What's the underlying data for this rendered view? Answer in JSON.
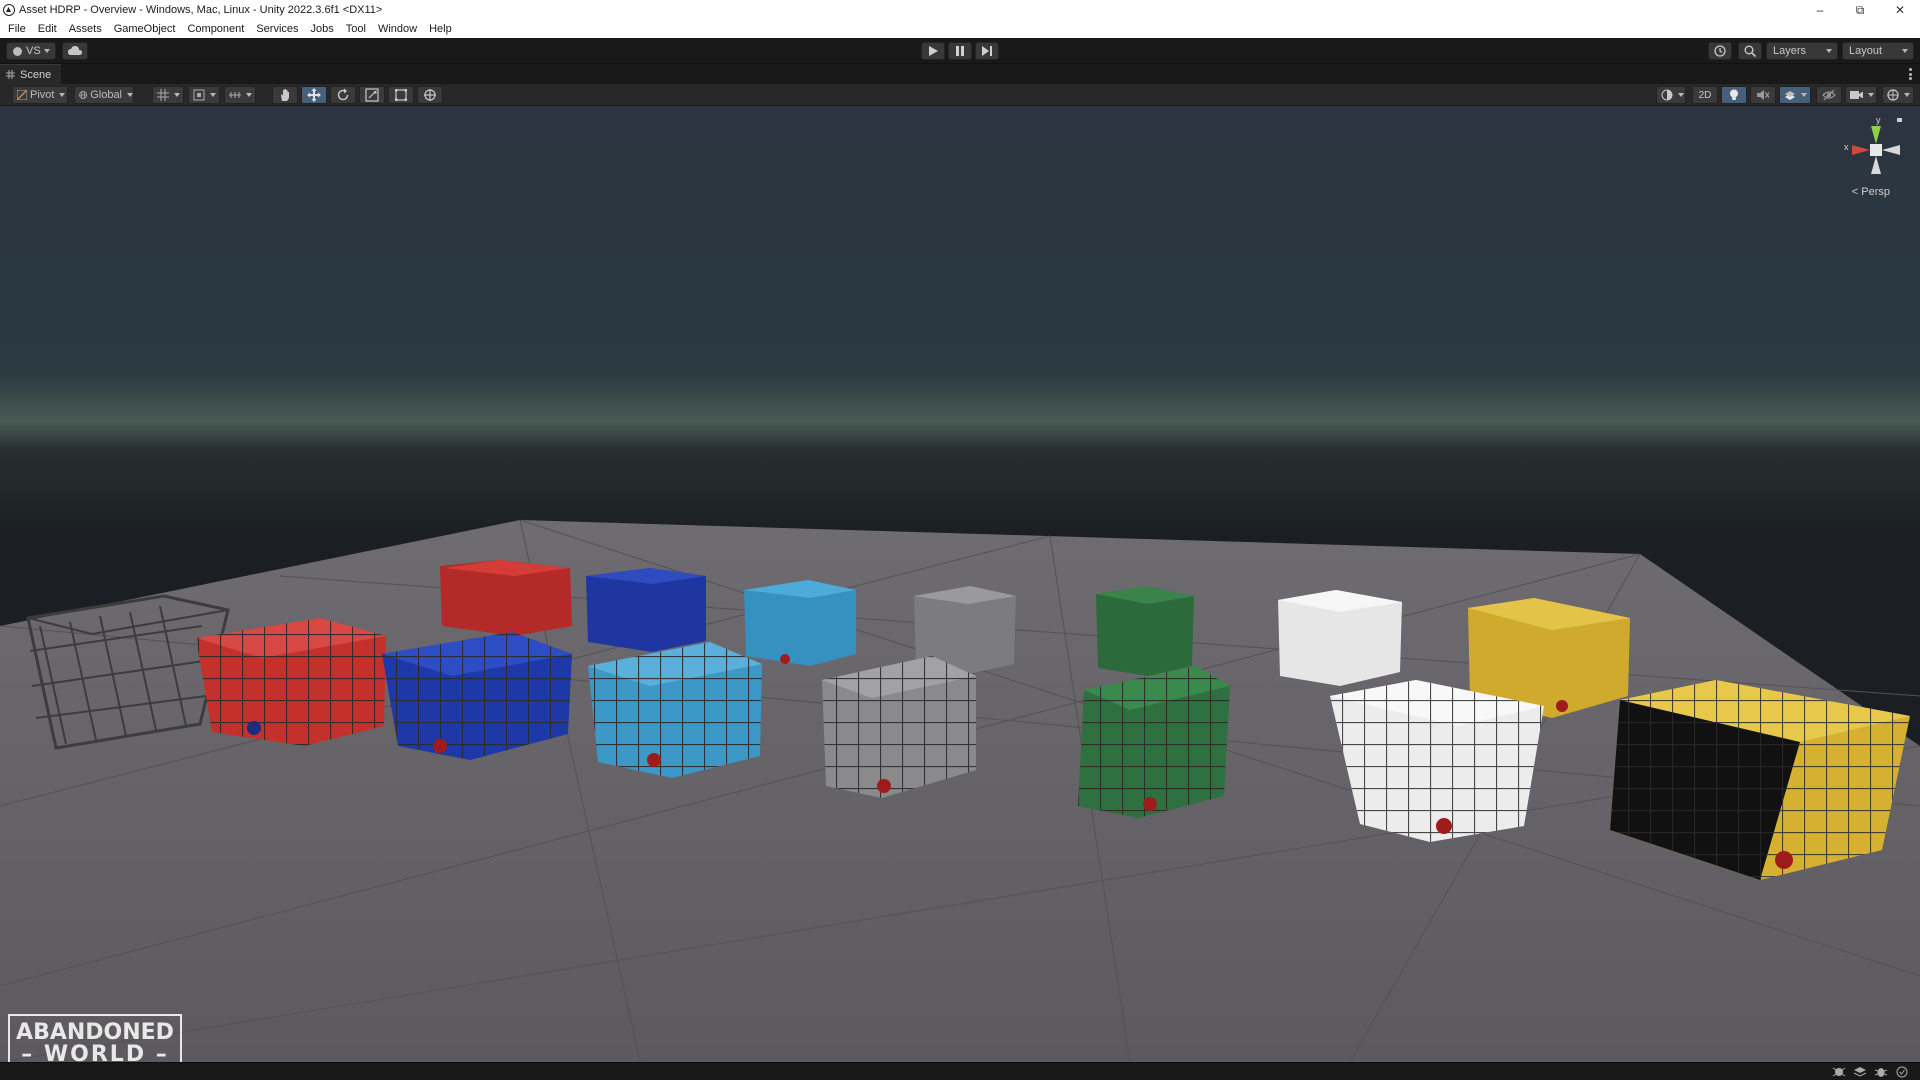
{
  "window": {
    "title": "Asset HDRP - Overview - Windows, Mac, Linux - Unity 2022.3.6f1 <DX11>",
    "controls": [
      "minimize-icon",
      "restore-icon",
      "close-icon"
    ]
  },
  "menu": {
    "items": [
      "File",
      "Edit",
      "Assets",
      "GameObject",
      "Component",
      "Services",
      "Jobs",
      "Tool",
      "Window",
      "Help"
    ]
  },
  "toolbar": {
    "account_label": "VS",
    "play_controls": [
      "play-icon",
      "pause-icon",
      "step-icon"
    ],
    "layers_label": "Layers",
    "layout_label": "Layout"
  },
  "scene_tab": {
    "label": "Scene"
  },
  "scene_toolbar": {
    "pivot_label": "Pivot",
    "global_label": "Global",
    "mode_2d_label": "2D",
    "active_tool": "move"
  },
  "viewport": {
    "persp_label": "Persp",
    "gizmo_axes": [
      "y",
      "x"
    ],
    "watermark_line1": "ABANDONED",
    "watermark_line2": "WORLD"
  },
  "colors": {
    "editor_bg": "#191919",
    "panel_bg": "#282828",
    "active_blue": "#46607c",
    "container_colors": [
      "#7a7a7a",
      "#c8302e",
      "#1f3aa8",
      "#3796c2",
      "#808080",
      "#2e6b3e",
      "#e8e8e8",
      "#d6b030"
    ]
  }
}
